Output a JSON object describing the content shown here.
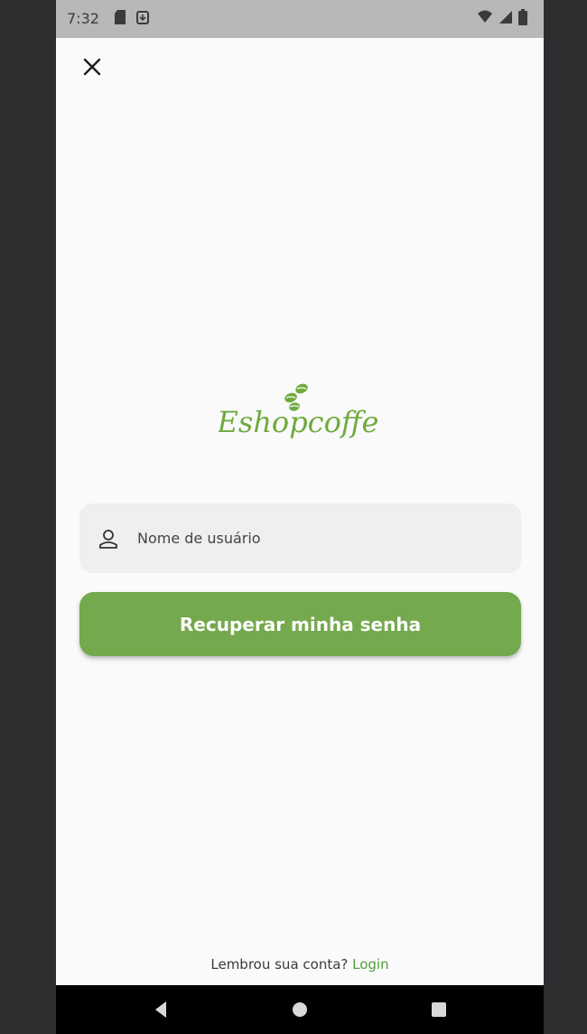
{
  "status_bar": {
    "time": "7:32",
    "left_icons": [
      "sd-card-icon",
      "download-box-icon"
    ],
    "right_icons": [
      "wifi-icon",
      "signal-icon",
      "battery-icon"
    ]
  },
  "header": {
    "close_icon": "close-icon"
  },
  "logo": {
    "text": "Eshopcoffe",
    "icon": "coffee-beans-icon",
    "color": "#6faa3e"
  },
  "form": {
    "username_placeholder": "Nome de usuário",
    "username_icon": "user-icon",
    "submit_label": "Recuperar minha senha",
    "button_color": "#75a94d"
  },
  "footer": {
    "prompt": "Lembrou sua conta? ",
    "link_label": "Login",
    "link_color": "#4f9e3e"
  },
  "nav_bar": {
    "buttons": [
      "back-icon",
      "home-icon",
      "recents-icon"
    ]
  }
}
